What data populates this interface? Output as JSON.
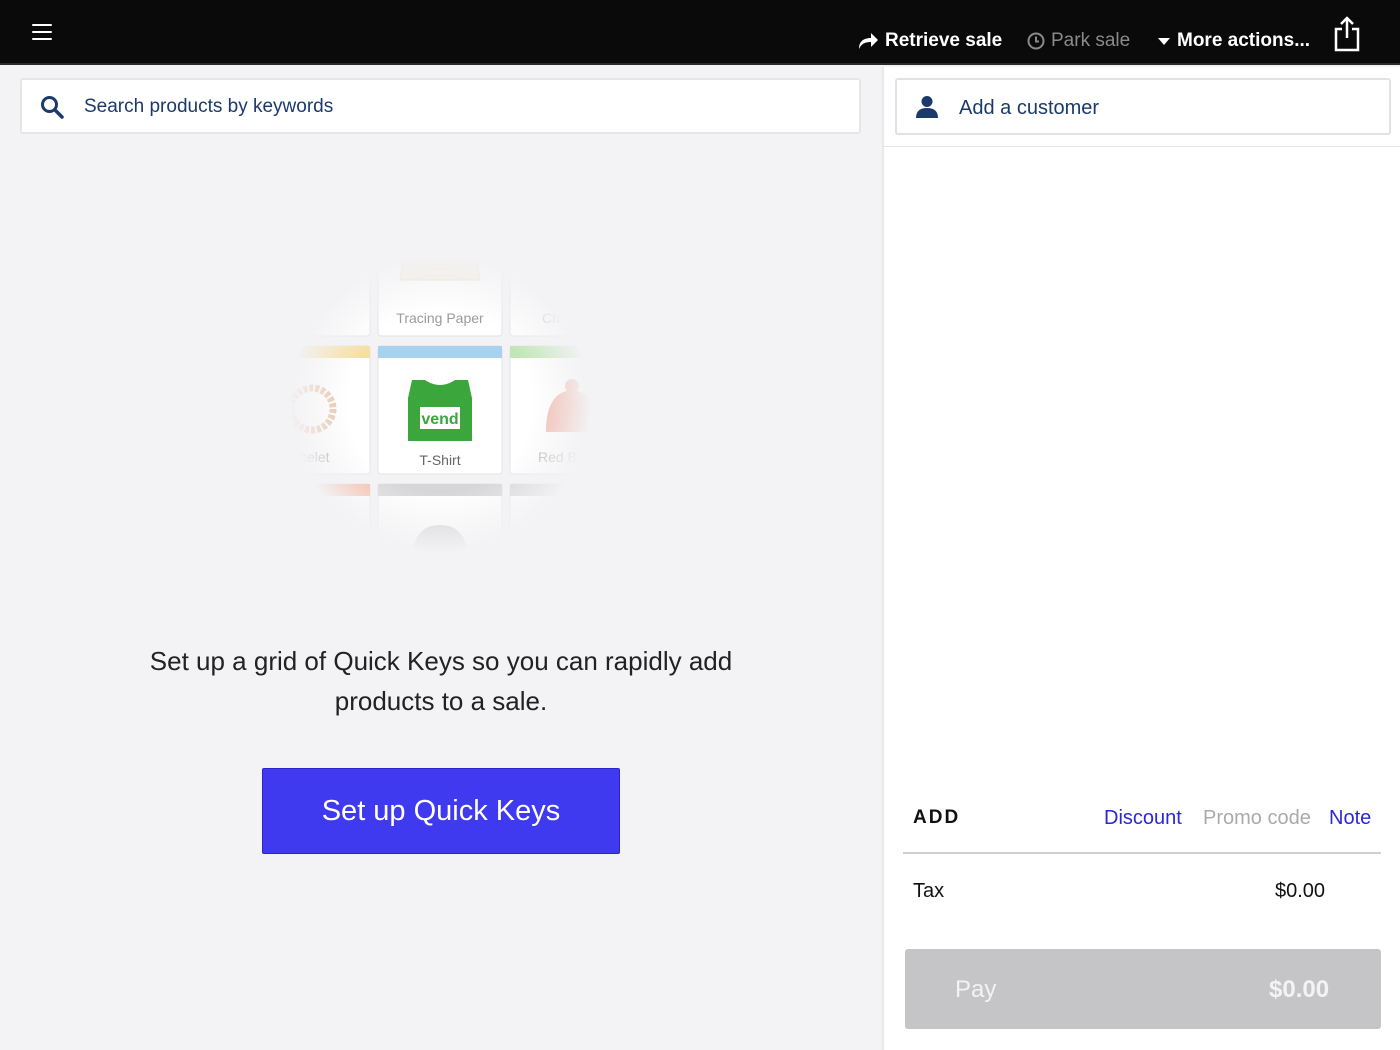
{
  "topbar": {
    "retrieve_label": "Retrieve sale",
    "park_label": "Park sale",
    "more_label": "More actions..."
  },
  "search": {
    "placeholder": "Search products by keywords"
  },
  "illustration": {
    "tile_labels": [
      "Tracing Paper",
      "Ch",
      "celet",
      "T-Shirt",
      "Red Be"
    ],
    "brand_text": "vend"
  },
  "quickkeys": {
    "message": "Set up a grid of Quick Keys so you can rapidly add products to a sale.",
    "button_label": "Set up Quick Keys"
  },
  "customer": {
    "label": "Add a customer"
  },
  "add_section": {
    "label": "ADD",
    "discount": "Discount",
    "promo": "Promo code",
    "note": "Note"
  },
  "totals": {
    "tax_label": "Tax",
    "tax_value": "$0.00"
  },
  "pay": {
    "label": "Pay",
    "amount": "$0.00"
  },
  "colors": {
    "accent": "#3f39ef",
    "link": "#2c27d6",
    "topbar": "#0a0a0a",
    "pay_disabled": "#c5c5c7"
  }
}
